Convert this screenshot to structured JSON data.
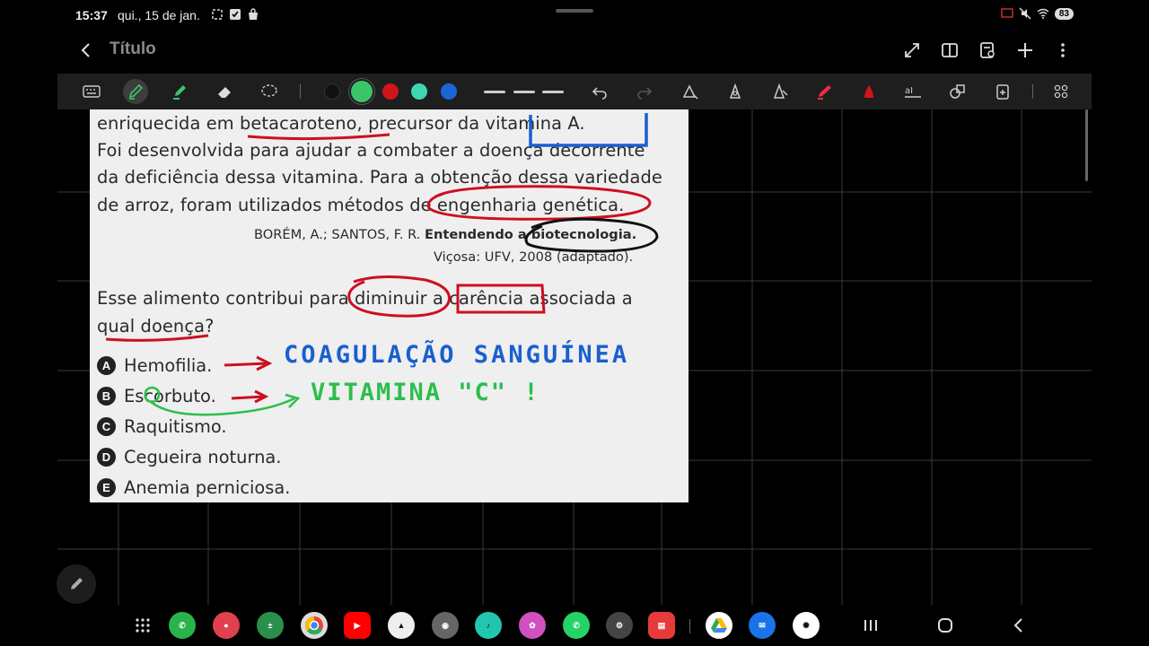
{
  "status_bar": {
    "time": "15:37",
    "date": "qui., 15 de jan.",
    "battery": "83"
  },
  "title_bar": {
    "title": "Título"
  },
  "toolbar": {
    "colors": [
      "#111111",
      "#3cc46a",
      "#d0151b",
      "#3fd6b4",
      "#1a66d6"
    ],
    "selected_color_index": 1
  },
  "document": {
    "lines": [
      "enriquecida em betacaroteno, precursor da vitamina A.",
      "Foi desenvolvida para ajudar a combater a doença decorrente",
      "da deficiência dessa vitamina. Para a obtenção dessa variedade",
      "de arroz, foram utilizados métodos de engenharia genética."
    ],
    "citation_author": "BORÉM, A.; SANTOS, F. R.",
    "citation_title": "Entendendo a biotecnologia.",
    "citation_place": "Viçosa: UFV, 2008 (adaptado).",
    "question_line1": "Esse alimento contribui para diminuir a carência associada a",
    "question_line2": "qual doença?",
    "options": [
      {
        "letter": "A",
        "text": "Hemofilia."
      },
      {
        "letter": "B",
        "text": "Escorbuto."
      },
      {
        "letter": "C",
        "text": "Raquitismo."
      },
      {
        "letter": "D",
        "text": "Cegueira noturna."
      },
      {
        "letter": "E",
        "text": "Anemia perniciosa."
      }
    ]
  },
  "handwriting": {
    "note_a": "COAGULAÇÃO  SANGUÍNEA",
    "note_b": "VITAMINA \"C\" !"
  }
}
